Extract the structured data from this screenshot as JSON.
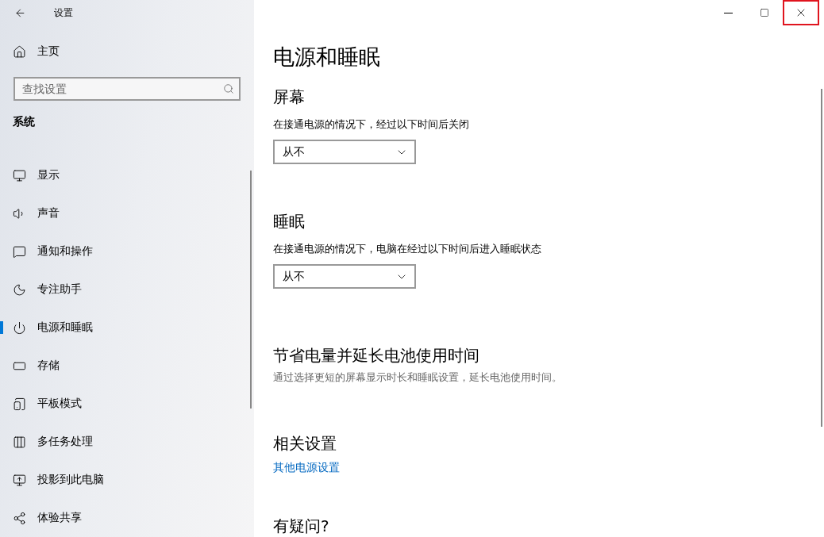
{
  "window": {
    "title": "设置",
    "controls": [
      {
        "kind": "minimize",
        "highlighted": false
      },
      {
        "kind": "maximize",
        "highlighted": false
      },
      {
        "kind": "close",
        "highlighted": true
      }
    ]
  },
  "sidebar": {
    "home": "主页",
    "search": {
      "placeholder": "查找设置"
    },
    "section": "系统",
    "items": [
      {
        "label": "显示",
        "selected": false
      },
      {
        "label": "声音",
        "selected": false
      },
      {
        "label": "通知和操作",
        "selected": false
      },
      {
        "label": "专注助手",
        "selected": false
      },
      {
        "label": "电源和睡眠",
        "selected": true
      },
      {
        "label": "存储",
        "selected": false
      },
      {
        "label": "平板模式",
        "selected": false
      },
      {
        "label": "多任务处理",
        "selected": false
      },
      {
        "label": "投影到此电脑",
        "selected": false
      },
      {
        "label": "体验共享",
        "selected": false
      }
    ]
  },
  "page": {
    "title": "电源和睡眠",
    "sections": [
      {
        "kind": "setting",
        "heading": "屏幕",
        "label": "在接通电源的情况下，经过以下时间后关闭",
        "value": "从不"
      },
      {
        "kind": "setting",
        "heading": "睡眠",
        "label": "在接通电源的情况下，电脑在经过以下时间后进入睡眠状态",
        "value": "从不"
      },
      {
        "kind": "info",
        "heading": "节省电量并延长电池使用时间",
        "text": "通过选择更短的屏幕显示时长和睡眠设置，延长电池使用时间。"
      },
      {
        "kind": "links",
        "heading": "相关设置",
        "links": [
          "其他电源设置"
        ]
      },
      {
        "kind": "heading",
        "heading": "有疑问?"
      }
    ]
  }
}
